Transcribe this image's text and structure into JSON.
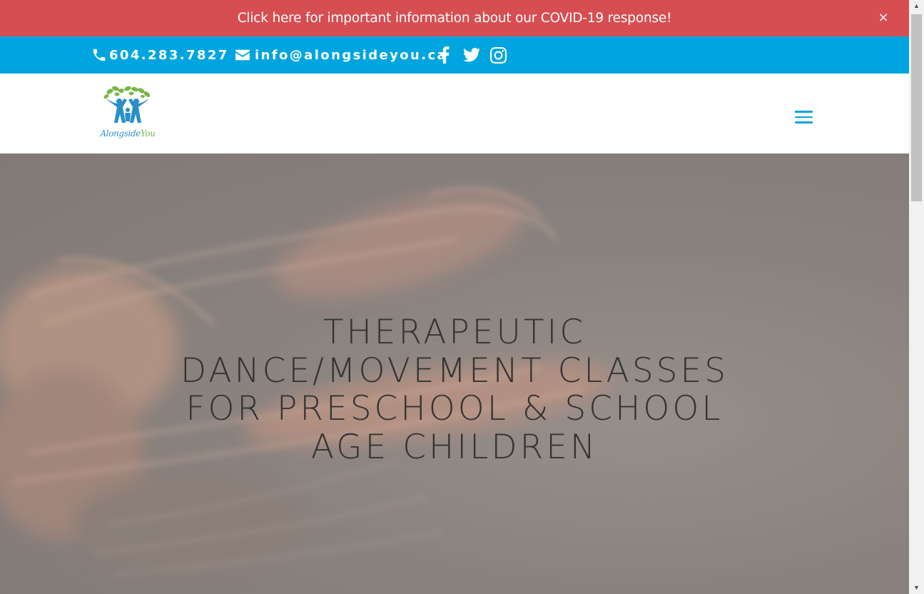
{
  "covid_banner": {
    "text": "Click here for important information about our COVID-19 response!",
    "close_label": "×"
  },
  "contact": {
    "phone": "604.283.7827",
    "email": "info@alongsideyou.ca"
  },
  "social": [
    "facebook-icon",
    "twitter-icon",
    "instagram-icon"
  ],
  "logo": {
    "text_main": "Alongside",
    "text_accent": "You"
  },
  "hero": {
    "title": "THERAPEUTIC DANCE/MOVEMENT CLASSES FOR PRESCHOOL & SCHOOL AGE CHILDREN"
  },
  "colors": {
    "banner": "#d64e52",
    "contact_bar": "#00a5e0",
    "accent": "#00a5e0"
  }
}
